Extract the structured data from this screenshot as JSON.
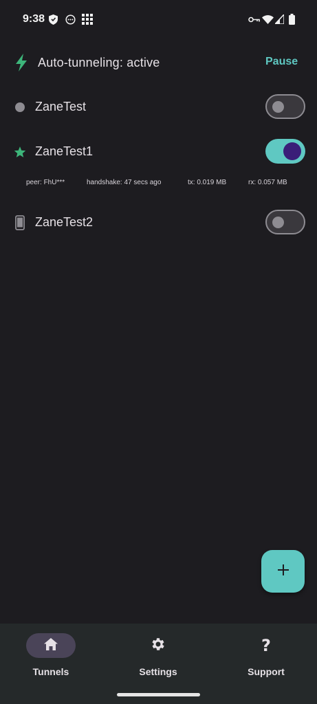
{
  "status_bar": {
    "time": "9:38",
    "left_icons": [
      "vpn-shield-icon",
      "more-circle-icon",
      "grid-app-icon"
    ],
    "right_icons": [
      "vpn-key-icon",
      "wifi-icon",
      "cellular-signal-icon",
      "battery-icon"
    ]
  },
  "auto_tunnel": {
    "icon": "bolt-icon",
    "label": "Auto-tunneling: active",
    "action_label": "Pause",
    "accent_color": "#5fc8c2"
  },
  "tunnels": [
    {
      "name": "ZaneTest",
      "icon": "dot-icon",
      "enabled": false
    },
    {
      "name": "ZaneTest1",
      "icon": "star-icon",
      "enabled": true,
      "stats": {
        "peer": "peer: FhU***",
        "handshake": "handshake: 47 secs ago",
        "tx": "tx: 0.019 MB",
        "rx": "rx: 0.057 MB"
      }
    },
    {
      "name": "ZaneTest2",
      "icon": "phone-icon",
      "enabled": false
    }
  ],
  "fab": {
    "icon": "plus-icon"
  },
  "bottom_nav": {
    "items": [
      {
        "label": "Tunnels",
        "icon": "home-icon",
        "active": true
      },
      {
        "label": "Settings",
        "icon": "gear-icon",
        "active": false
      },
      {
        "label": "Support",
        "icon": "question-icon",
        "active": false
      }
    ]
  },
  "colors": {
    "background": "#1d1c20",
    "accent": "#5fc8c2",
    "star_green": "#3db57a",
    "nav_background": "#25292a"
  }
}
